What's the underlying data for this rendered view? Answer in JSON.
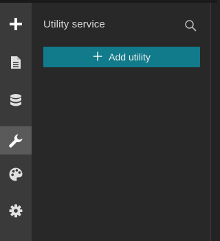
{
  "rail": {
    "items": [
      {
        "icon": "plus-icon",
        "active": false
      },
      {
        "icon": "document-icon",
        "active": false
      },
      {
        "icon": "database-icon",
        "active": false
      },
      {
        "icon": "wrench-icon",
        "active": true
      },
      {
        "icon": "palette-icon",
        "active": false
      },
      {
        "icon": "gear-icon",
        "active": false
      }
    ]
  },
  "panel": {
    "title": "Utility service",
    "search_icon": "search-icon",
    "add_button_icon": "plus-icon",
    "add_button_label": "Add utility"
  },
  "colors": {
    "accent": "#117a8b",
    "rail_background": "#3a3a3a",
    "rail_active": "#5a5a5a",
    "panel_background": "#282828"
  }
}
